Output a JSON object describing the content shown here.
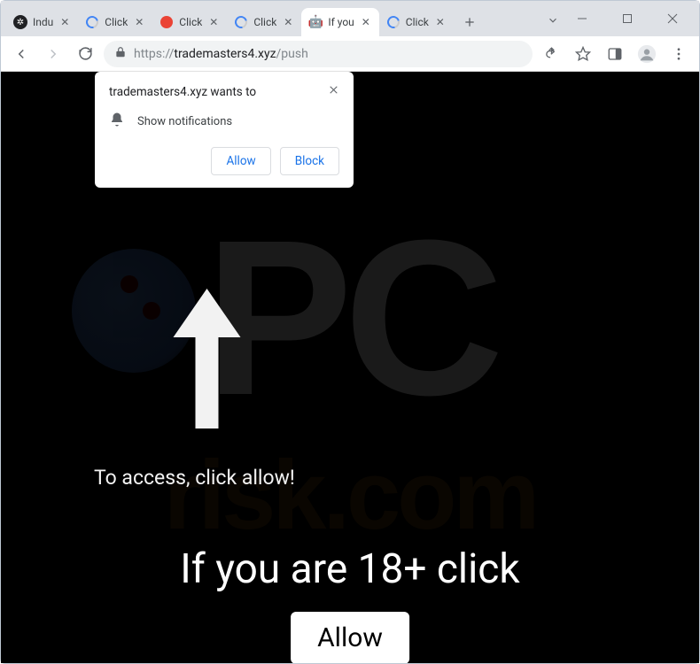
{
  "window": {
    "tabs": [
      {
        "title": "Indu",
        "favicon": "movie"
      },
      {
        "title": "Click",
        "favicon": "recaptcha"
      },
      {
        "title": "Click",
        "favicon": "red"
      },
      {
        "title": "Click",
        "favicon": "recaptcha"
      },
      {
        "title": "If you",
        "favicon": "robot",
        "active": true
      },
      {
        "title": "Click",
        "favicon": "recaptcha"
      }
    ]
  },
  "omnibox": {
    "scheme": "https://",
    "host": "trademasters4.xyz",
    "path": "/push"
  },
  "permission_prompt": {
    "origin": "trademasters4.xyz wants to",
    "message": "Show notifications",
    "allow": "Allow",
    "block": "Block"
  },
  "page": {
    "access_text": "To access, click allow!",
    "age_text": "If you are 18+ click",
    "allow_button": "Allow"
  },
  "watermark": {
    "top": "PC",
    "bottom": "risk.com"
  }
}
